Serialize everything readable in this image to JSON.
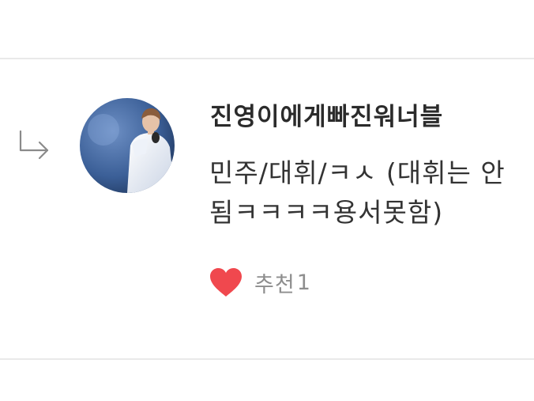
{
  "comment": {
    "author": "진영이에게빠진워너블",
    "text": "민주/대휘/ㅋㅅ (대휘는 안됨ㅋㅋㅋㅋ용서못함)",
    "avatar_icon": "user-photo-avatar"
  },
  "recommend": {
    "icon": "heart-icon",
    "icon_color": "#f0484e",
    "label": "추천",
    "count": "1"
  },
  "icons": {
    "reply": "reply-arrow-icon"
  }
}
